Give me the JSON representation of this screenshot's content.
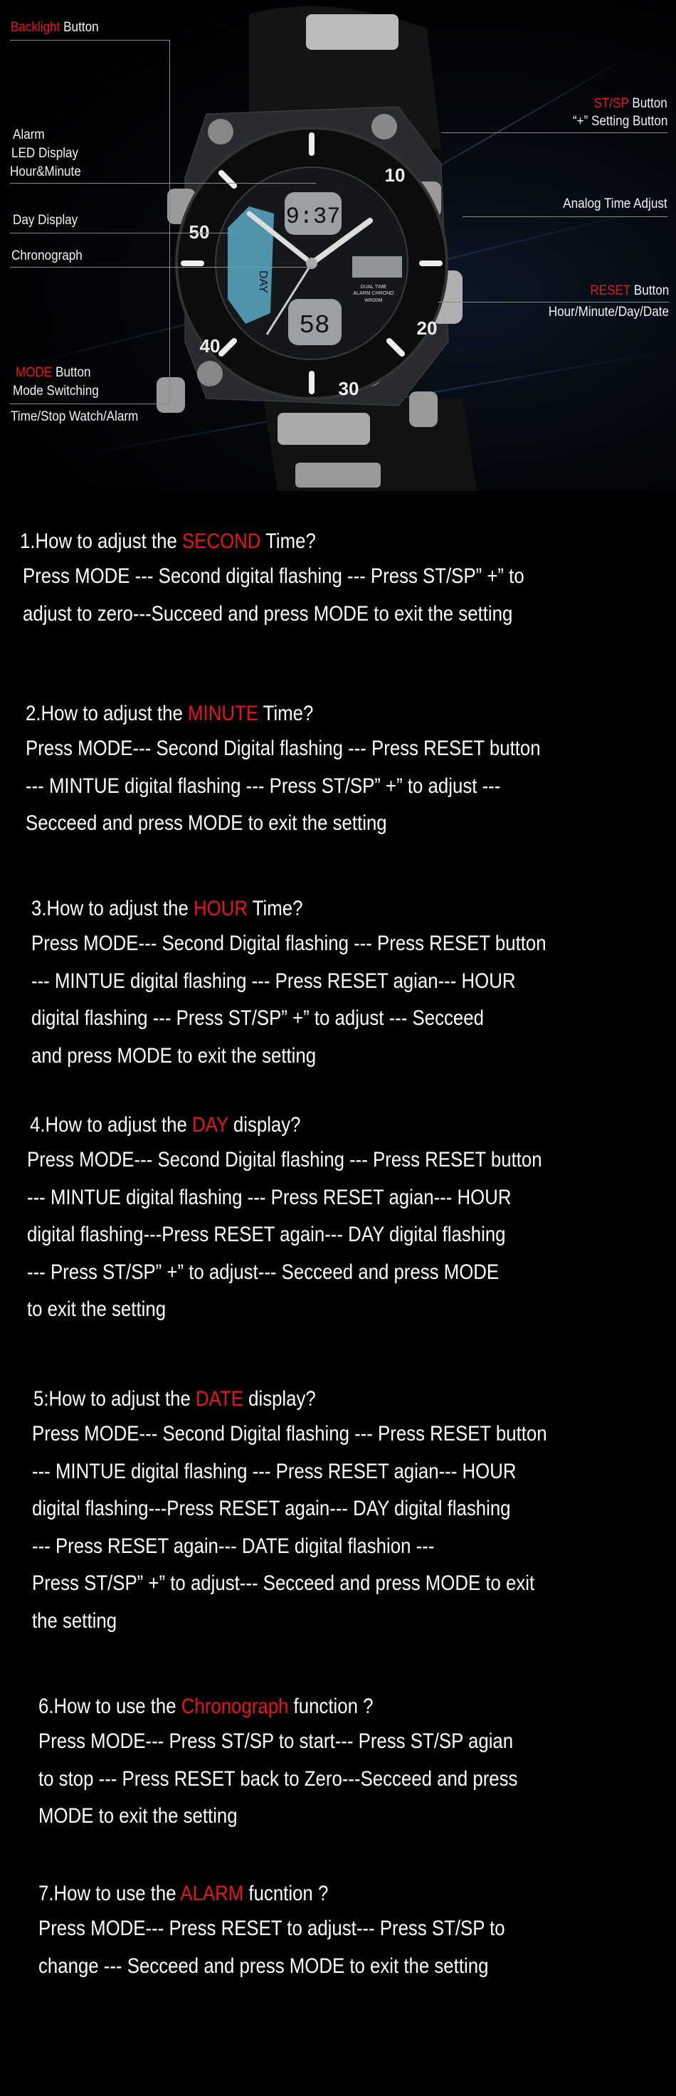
{
  "diagram": {
    "left_labels": {
      "backlight": {
        "highlight": "Backlight",
        "rest": " Button"
      },
      "alarm_led": [
        "Alarm",
        "LED Display",
        "Hour&Minute"
      ],
      "day_display": "Day Display",
      "chronograph": "Chronograph",
      "mode": {
        "highlight": "MODE",
        "rest": " Button",
        "line2": "Mode Switching",
        "line3": "Time/Stop Watch/Alarm"
      }
    },
    "right_labels": {
      "stsp": {
        "highlight": "ST/SP",
        "rest": " Button",
        "line2": "“+” Setting Button"
      },
      "analog": "Analog Time Adjust",
      "reset": {
        "highlight": "RESET",
        "rest": " Button",
        "line2": "Hour/Minute/Day/Date"
      }
    },
    "watch_face": {
      "bezel_numbers": [
        "10",
        "20",
        "30",
        "40",
        "50"
      ],
      "digital_top": "9:37",
      "digital_bottom": "58",
      "dial_text": [
        "DUAL TIME",
        "ALARM CHRONO",
        "WR30M"
      ],
      "day_label": "DAY"
    },
    "highlight_color": "#e8141c"
  },
  "sections": [
    {
      "heading": {
        "prefix": "1.How to adjust the ",
        "highlight": "SECOND",
        "suffix": " Time?"
      },
      "lines": [
        "Press MODE --- Second digital flashing --- Press ST/SP”  +”  to",
        "adjust to zero---Succeed and press MODE to exit the setting"
      ]
    },
    {
      "heading": {
        "prefix": "2.How to adjust the ",
        "highlight": "MINUTE",
        "suffix": " Time?"
      },
      "lines": [
        "Press MODE--- Second Digital flashing --- Press RESET button",
        "--- MINTUE digital flashing --- Press ST/SP”  +”  to adjust ---",
        "Secceed and press MODE to exit the setting"
      ]
    },
    {
      "heading": {
        "prefix": "3.How to adjust the ",
        "highlight": "HOUR",
        "suffix": " Time?"
      },
      "lines": [
        "Press MODE--- Second Digital flashing --- Press RESET button",
        "--- MINTUE digital flashing --- Press RESET agian--- HOUR",
        "digital flashing --- Press ST/SP”  +”  to adjust --- Secceed",
        "and press MODE to exit the setting"
      ]
    },
    {
      "heading": {
        "prefix": "4.How to adjust the ",
        "highlight": "DAY",
        "suffix": " display?"
      },
      "lines": [
        "Press MODE--- Second Digital flashing --- Press RESET button",
        "--- MINTUE digital flashing --- Press RESET agian--- HOUR",
        "digital flashing---Press RESET again--- DAY digital flashing",
        "--- Press ST/SP”  +”  to adjust--- Secceed and press MODE",
        "to exit the setting"
      ]
    },
    {
      "heading": {
        "prefix": "5:How to adjust the ",
        "highlight": "DATE",
        "suffix": " display?"
      },
      "lines": [
        "Press MODE--- Second Digital flashing --- Press RESET button",
        "--- MINTUE digital flashing --- Press RESET agian--- HOUR",
        "digital flashing---Press RESET again--- DAY digital flashing",
        "--- Press RESET again--- DATE digital flashion ---",
        "Press ST/SP”  +”  to adjust--- Secceed and press MODE to exit",
        "the setting"
      ]
    },
    {
      "heading": {
        "prefix": "6.How to use the ",
        "highlight": "Chronograph",
        "suffix": " function ?"
      },
      "lines": [
        "Press MODE--- Press ST/SP to start--- Press ST/SP agian",
        "to stop --- Press RESET back to Zero---Secceed and press",
        "MODE to exit the setting"
      ]
    },
    {
      "heading": {
        "prefix": "7.How to use the ",
        "highlight": "ALARM",
        "suffix": " fucntion ?"
      },
      "lines": [
        "Press MODE--- Press RESET to adjust--- Press ST/SP to",
        "change --- Secceed and press MODE to exit the setting"
      ]
    }
  ]
}
